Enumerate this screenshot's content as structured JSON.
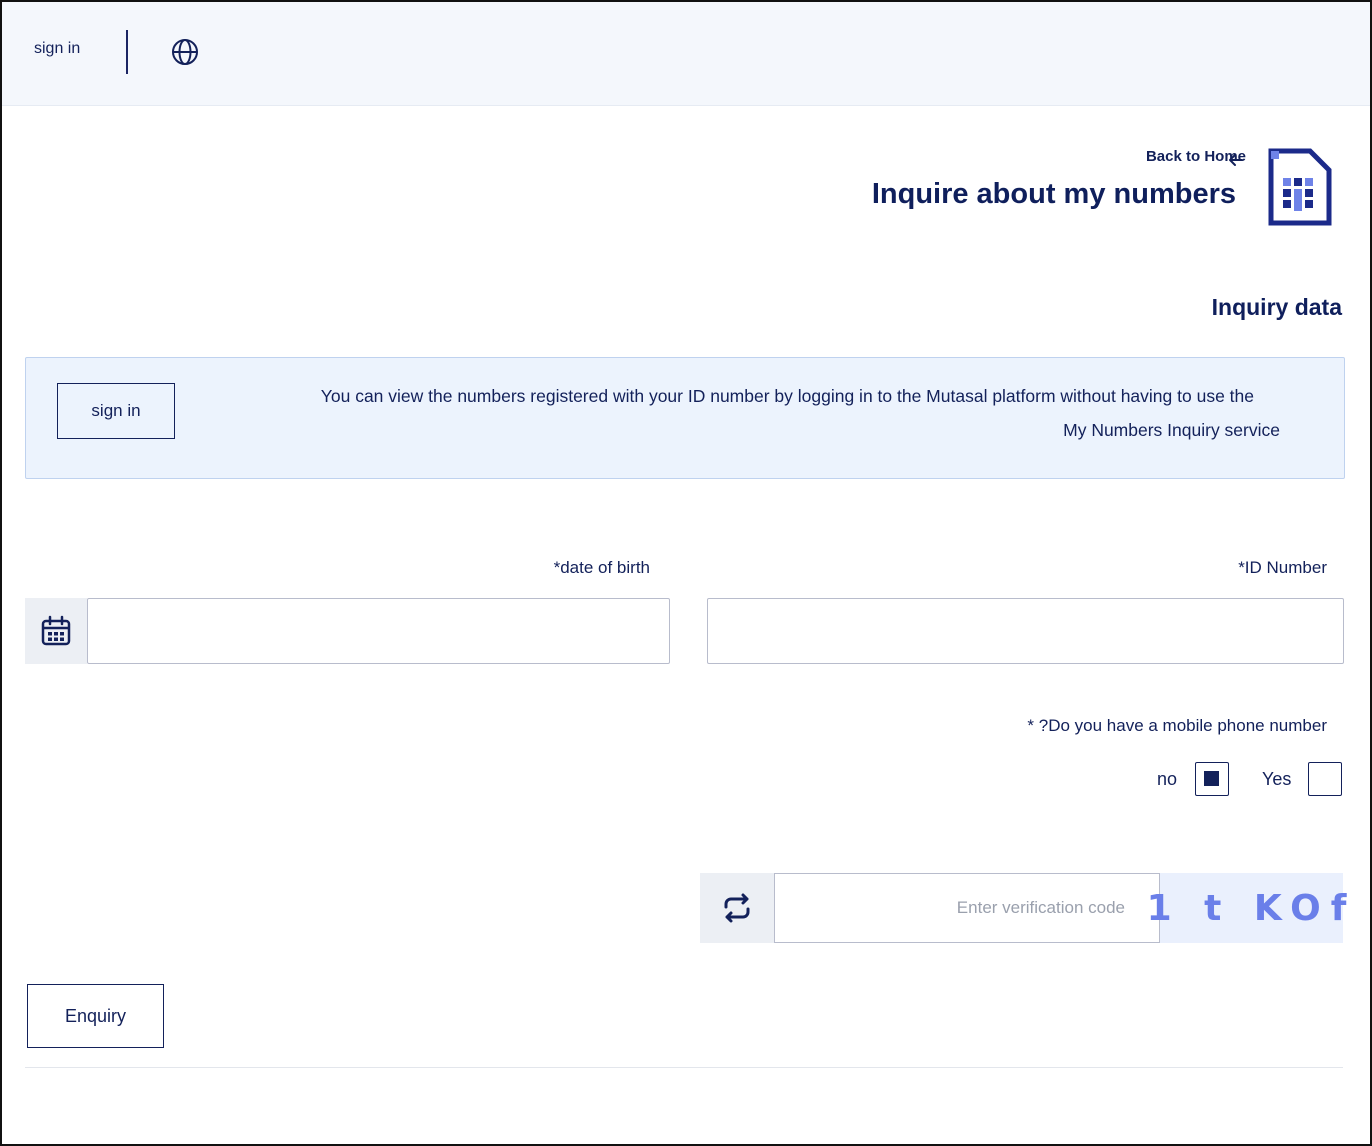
{
  "header": {
    "sign_in_label": "sign in",
    "language_icon": "globe-icon"
  },
  "page": {
    "back_link": "Back to Home",
    "title": "Inquire about my numbers",
    "section_title": "Inquiry data"
  },
  "info": {
    "sign_in_button": "sign in",
    "line1": "You can view the numbers registered with your ID number by logging in to the Mutasal platform without having to use the",
    "line2": "My Numbers Inquiry service"
  },
  "form": {
    "dob_label": "*date of birth",
    "dob_value": "",
    "id_label": "*ID Number",
    "id_value": "",
    "mobile_question": "* ?Do you have a mobile phone number",
    "option_no": "no",
    "option_yes": "Yes",
    "selected_option": "no",
    "captcha_placeholder": "Enter verification code",
    "captcha_code": "1 t KOf",
    "submit_label": "Enquiry"
  },
  "colors": {
    "primary": "#13215a",
    "info_bg": "#ecf3fd",
    "captcha_text": "#6a7fe9",
    "topbar_bg": "#f4f7fc"
  }
}
